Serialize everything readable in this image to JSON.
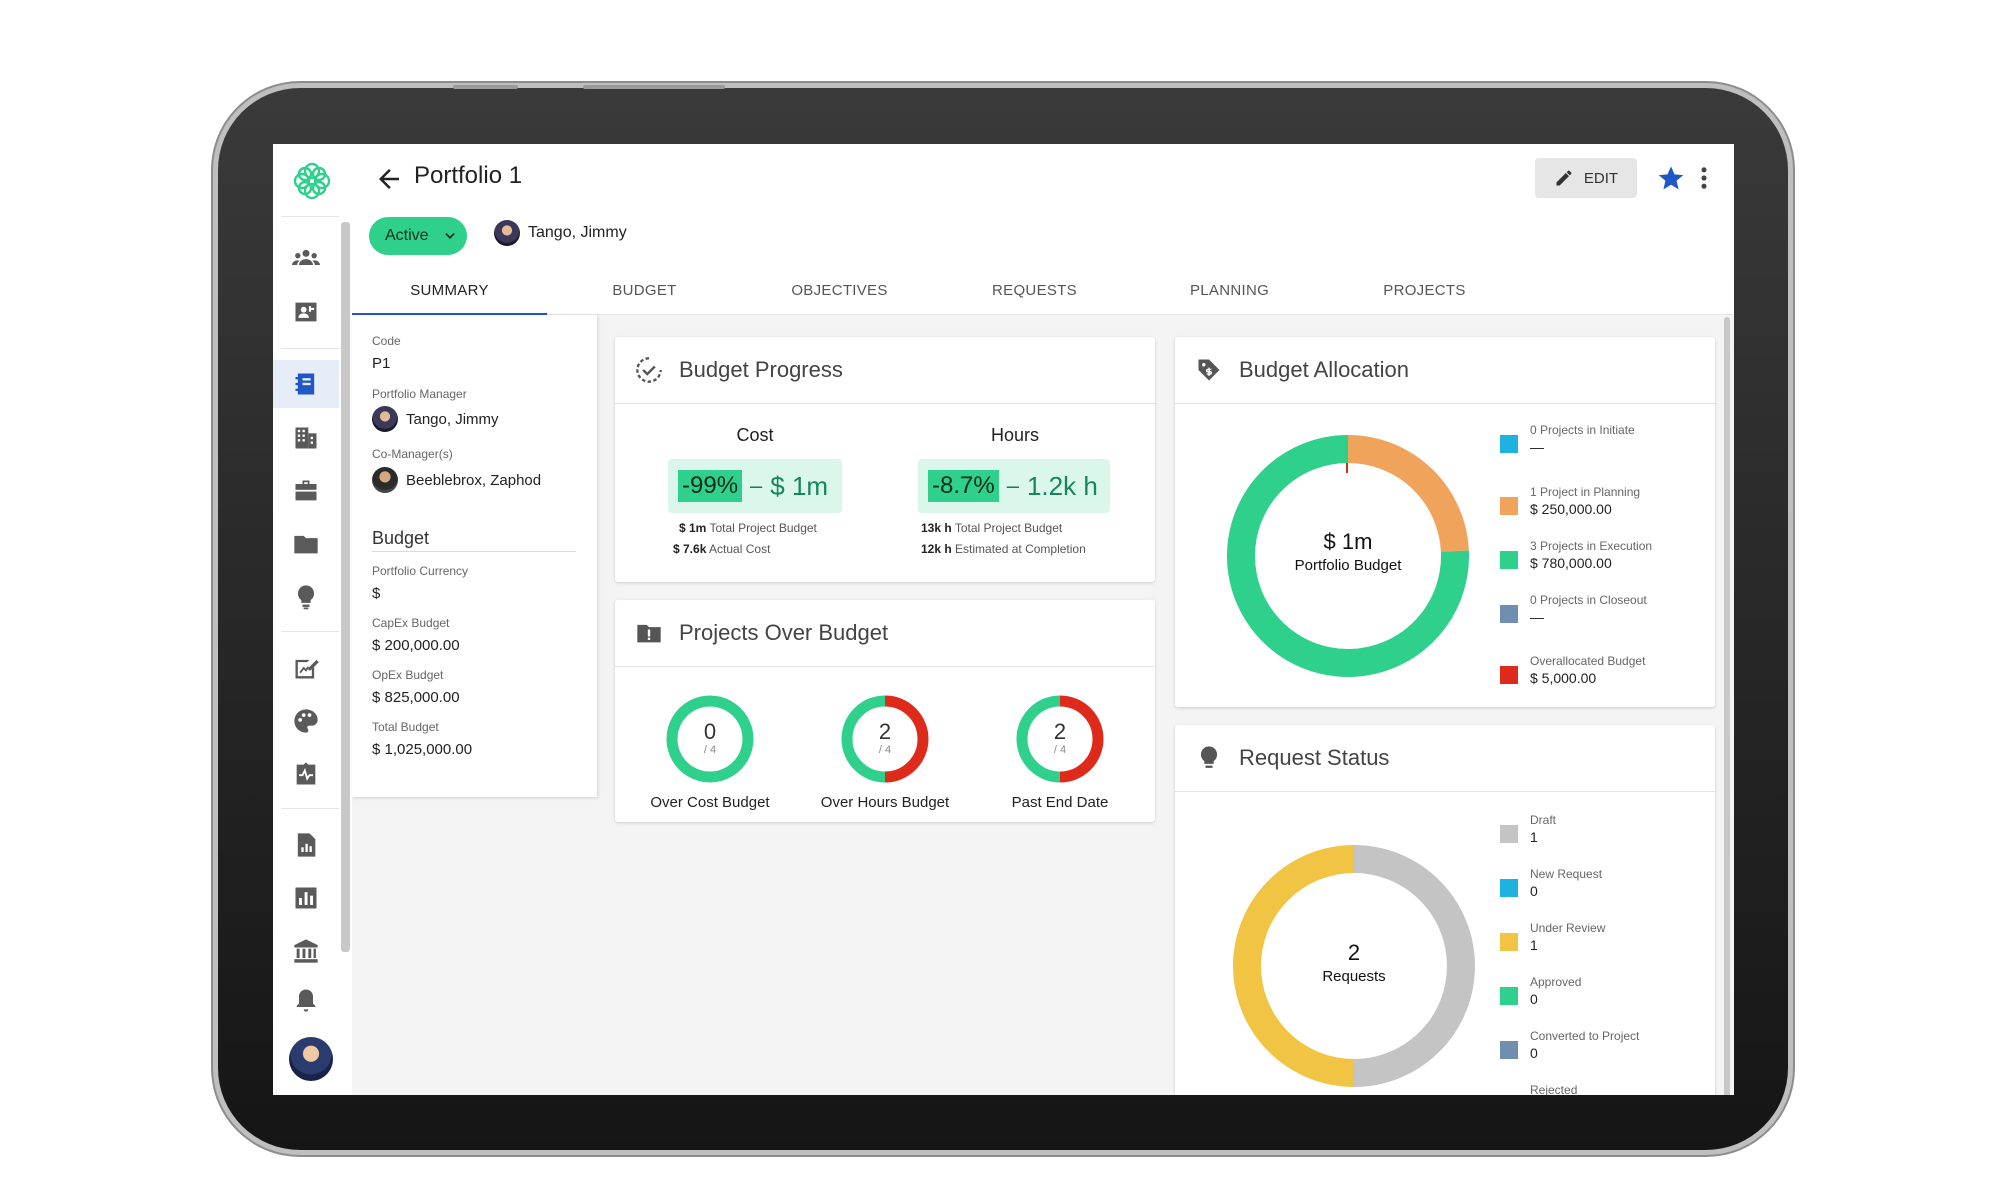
{
  "header": {
    "title": "Portfolio 1",
    "edit_label": "EDIT",
    "status": "Active",
    "owner": "Tango, Jimmy"
  },
  "tabs": [
    "SUMMARY",
    "BUDGET",
    "OBJECTIVES",
    "REQUESTS",
    "PLANNING",
    "PROJECTS"
  ],
  "sidebar": {
    "items": [
      "people-icon",
      "contact-icon",
      "notebook-icon",
      "building-icon",
      "briefcase-icon",
      "folder-icon",
      "lightbulb-icon",
      "edit-chart-icon",
      "palette-icon",
      "health-icon",
      "report-icon",
      "bar-chart-icon",
      "bank-icon",
      "bell-icon"
    ],
    "active": "notebook-icon"
  },
  "info": {
    "code_label": "Code",
    "code": "P1",
    "manager_label": "Portfolio Manager",
    "manager": "Tango, Jimmy",
    "comanager_label": "Co-Manager(s)",
    "comanager": "Beeblebrox, Zaphod",
    "budget_heading": "Budget",
    "currency_label": "Portfolio Currency",
    "currency": "$",
    "capex_label": "CapEx Budget",
    "capex": "$ 200,000.00",
    "opex_label": "OpEx Budget",
    "opex": "$ 825,000.00",
    "total_label": "Total Budget",
    "total": "$ 1,025,000.00"
  },
  "budget_progress": {
    "title": "Budget Progress",
    "cost": {
      "title": "Cost",
      "delta": "-99%",
      "separator": "–",
      "amount": "$ 1m",
      "line1_value": "$ 1m",
      "line1_label": "Total Project Budget",
      "line2_value": "$ 7.6k",
      "line2_label": "Actual Cost"
    },
    "hours": {
      "title": "Hours",
      "delta": "-8.7%",
      "separator": "–",
      "amount": "1.2k h",
      "line1_value": "13k h",
      "line1_label": "Total Project Budget",
      "line2_value": "12k h",
      "line2_label": "Estimated at Completion"
    }
  },
  "over_budget": {
    "title": "Projects Over Budget",
    "items": [
      {
        "count": "0",
        "total": "/ 4",
        "label": "Over Cost Budget",
        "fraction": 0
      },
      {
        "count": "2",
        "total": "/ 4",
        "label": "Over Hours Budget",
        "fraction": 0.5
      },
      {
        "count": "2",
        "total": "/ 4",
        "label": "Past End Date",
        "fraction": 0.5
      }
    ],
    "colors": {
      "ok": "#2ed08c",
      "over": "#dd2a1b"
    }
  },
  "allocation": {
    "title": "Budget Allocation",
    "center_value": "$ 1m",
    "center_label": "Portfolio Budget",
    "legend": [
      {
        "name": "0 Projects in Initiate",
        "value": "—",
        "color": "#1db2e0"
      },
      {
        "name": "1 Project in Planning",
        "value": "$ 250,000.00",
        "color": "#f0a35a"
      },
      {
        "name": "3 Projects in Execution",
        "value": "$ 780,000.00",
        "color": "#2ed08c"
      },
      {
        "name": "0 Projects in Closeout",
        "value": "—",
        "color": "#6f8fb0"
      },
      {
        "name": "Overallocated Budget",
        "value": "$ 5,000.00",
        "color": "#dd2a1b"
      }
    ]
  },
  "request_status": {
    "title": "Request Status",
    "center_value": "2",
    "center_label": "Requests",
    "legend": [
      {
        "name": "Draft",
        "value": "1",
        "color": "#c4c4c4"
      },
      {
        "name": "New Request",
        "value": "0",
        "color": "#1db2e0"
      },
      {
        "name": "Under Review",
        "value": "1",
        "color": "#f2c443"
      },
      {
        "name": "Approved",
        "value": "0",
        "color": "#2ed08c"
      },
      {
        "name": "Converted to Project",
        "value": "0",
        "color": "#6f8fb0"
      },
      {
        "name": "Rejected",
        "value": "",
        "color": "#dd2a1b"
      }
    ]
  }
}
